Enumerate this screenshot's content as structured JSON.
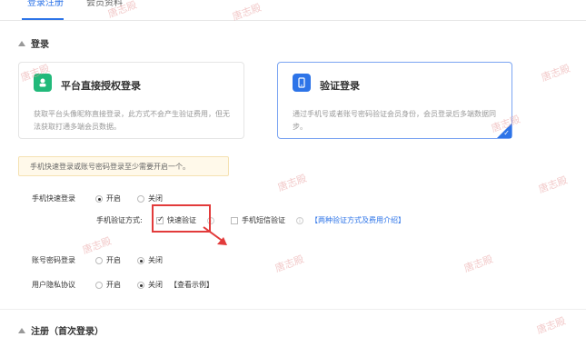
{
  "tabs": [
    "登录注册",
    "会员资料"
  ],
  "section_login": "登录",
  "cards": [
    {
      "title": "平台直接授权登录",
      "desc": "获取平台头像昵称直接登录，此方式不会产生验证费用，但无法获取打通多端会员数据。",
      "icon": "person-icon",
      "selected": false
    },
    {
      "title": "验证登录",
      "desc": "通过手机号或者账号密码验证会员身份，会员登录后多端数据同步。",
      "icon": "phone-icon",
      "selected": true
    }
  ],
  "notice": "手机快速登录或账号密码登录至少需要开启一个。",
  "phone_fast_login": {
    "label": "手机快速登录",
    "on": "开启",
    "off": "关闭",
    "value": "开启"
  },
  "verify_method": {
    "label": "手机验证方式:",
    "fast": "快速验证",
    "sms": "手机短信验证",
    "info": "i",
    "link": "【两种验证方式及费用介绍】",
    "fast_checked": true,
    "sms_checked": false
  },
  "account_login": {
    "label": "账号密码登录",
    "on": "开启",
    "off": "关闭",
    "value": "关闭"
  },
  "privacy": {
    "label": "用户隐私协议",
    "on": "开启",
    "off": "关闭",
    "value": "关闭",
    "link": "【查看示例】"
  },
  "section_register": "注册（首次登录）",
  "watermark": "唐志殿",
  "colors": {
    "accent": "#2d74e8",
    "highlight": "#e23b3b",
    "icon_green": "#21b97a"
  }
}
